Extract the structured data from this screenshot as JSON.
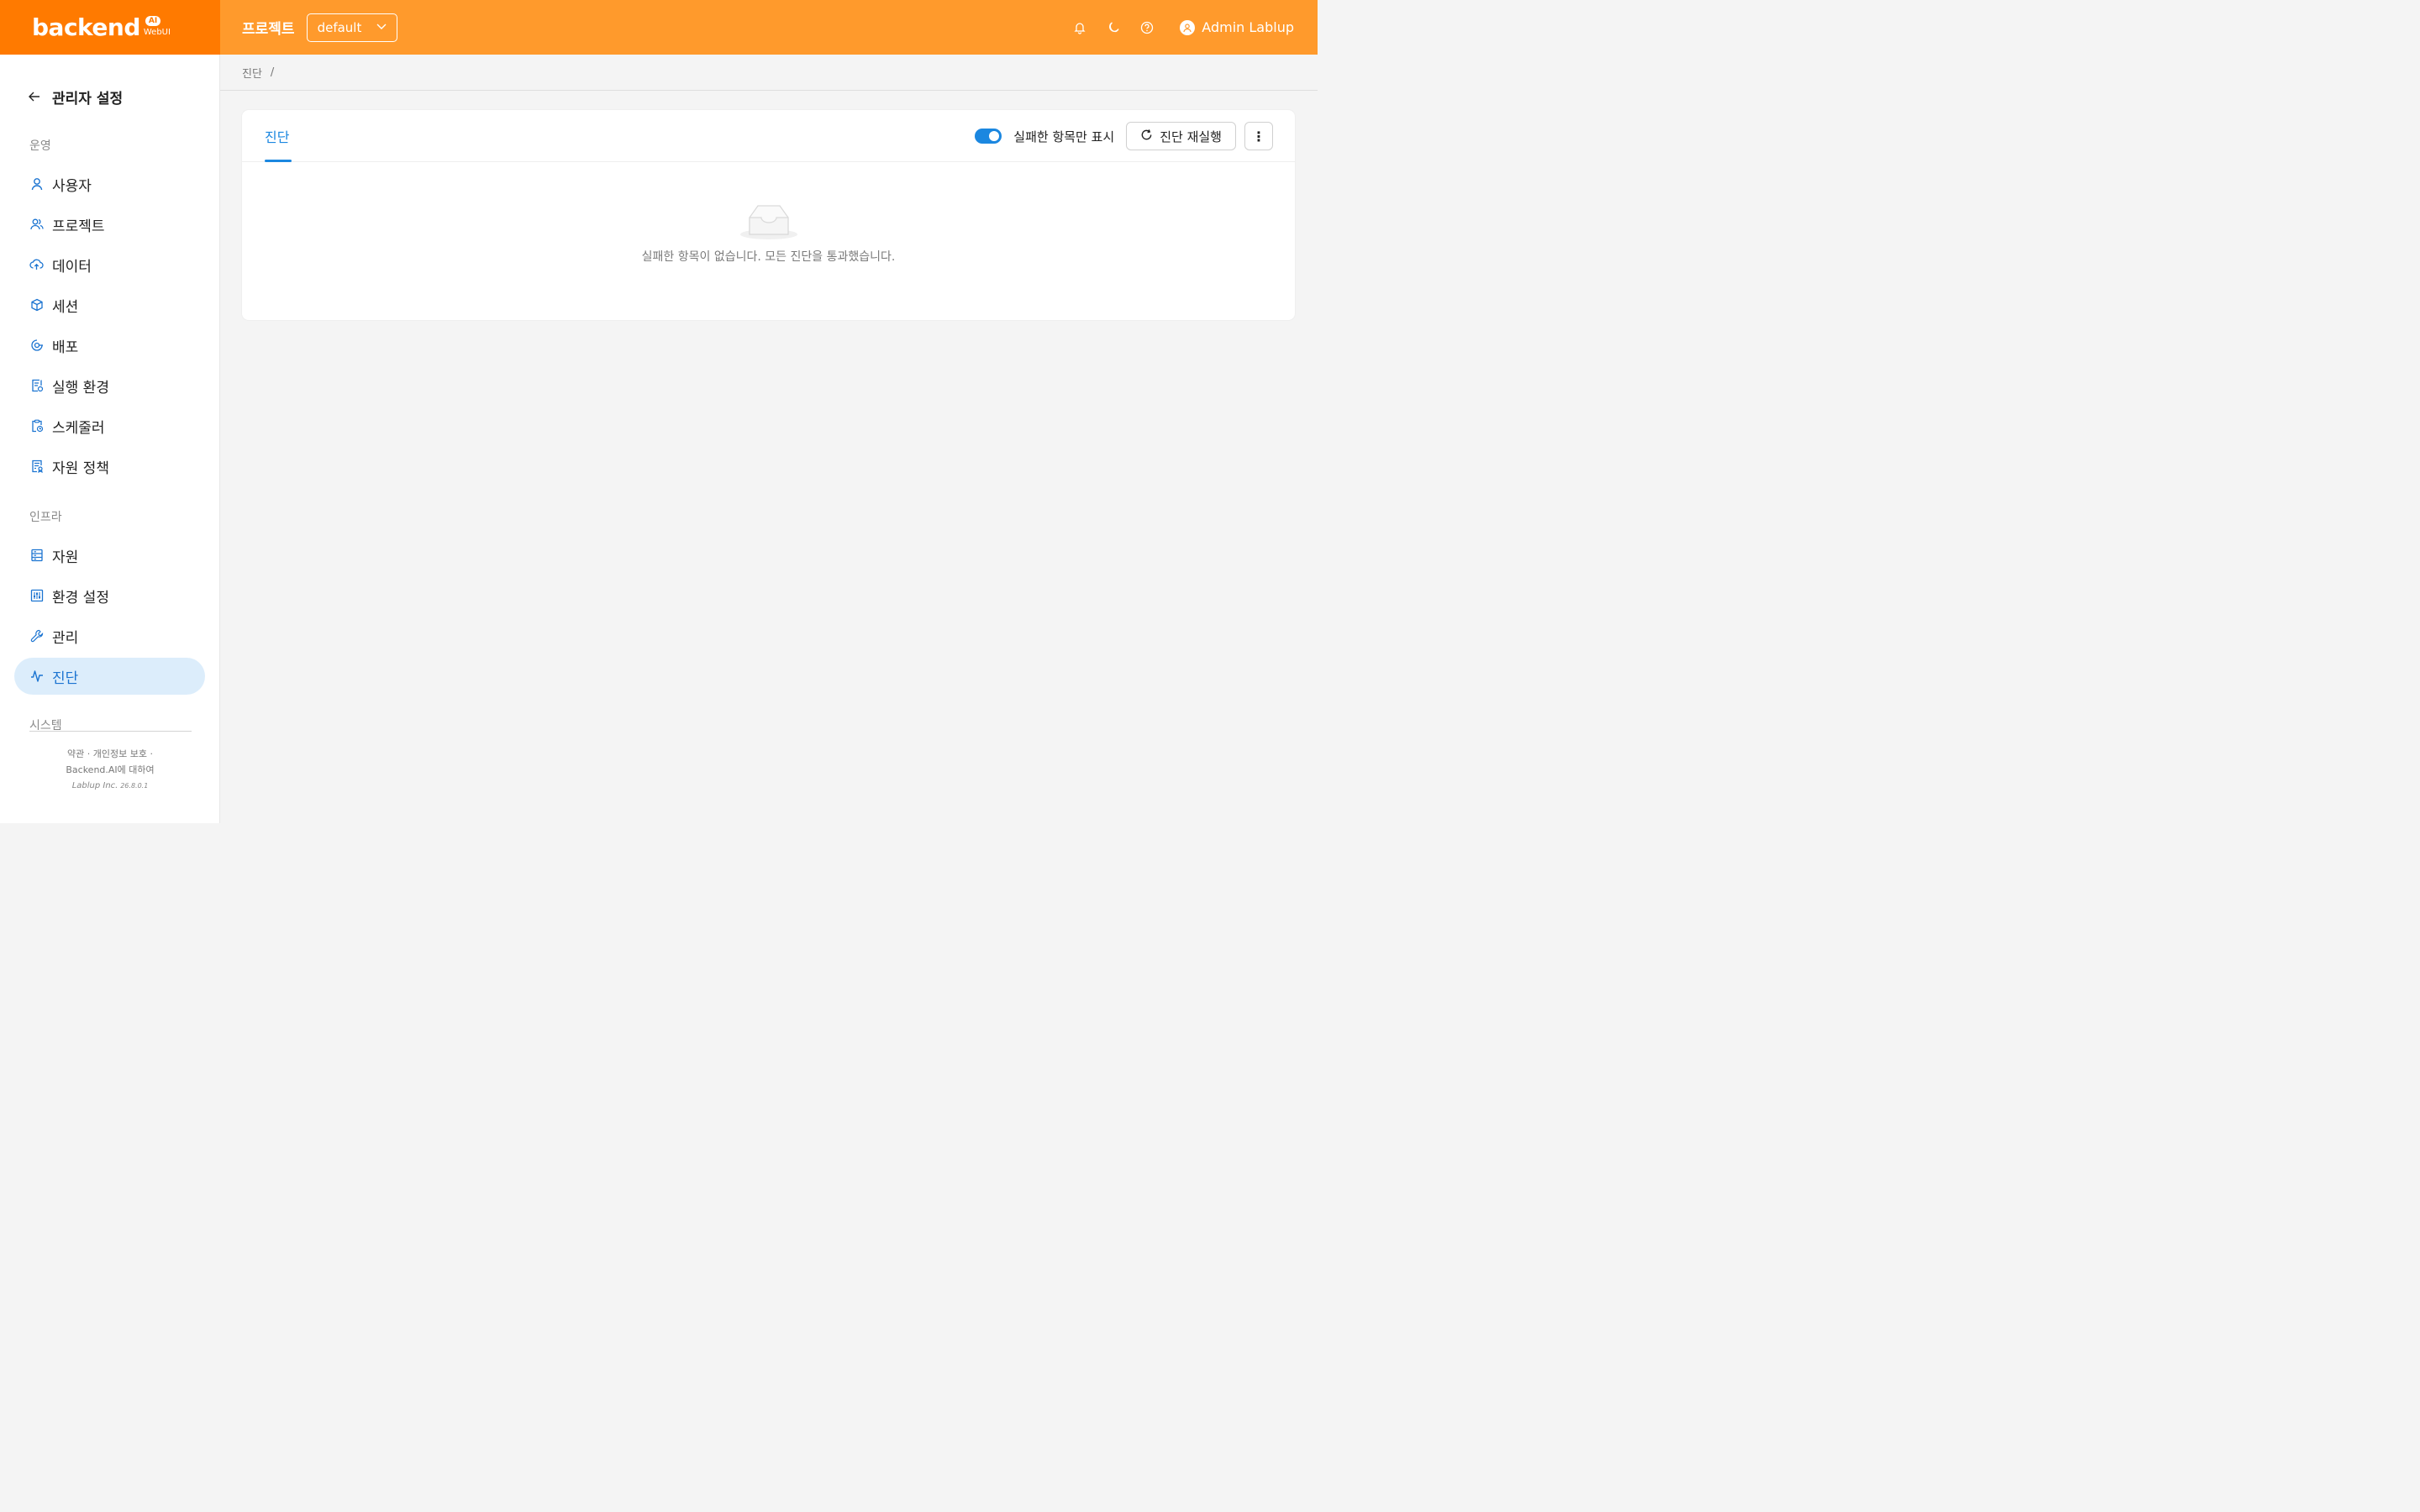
{
  "header": {
    "logo_text": "backend",
    "logo_badge": "AI",
    "logo_sub": "WebUI",
    "project_label": "프로젝트",
    "project_value": "default",
    "user_name": "Admin Lablup"
  },
  "sidebar": {
    "title": "관리자 설정",
    "section_operation": "운영",
    "section_infra": "인프라",
    "section_system": "시스템",
    "items": [
      {
        "label": "사용자",
        "icon": "user-icon"
      },
      {
        "label": "프로젝트",
        "icon": "users-icon"
      },
      {
        "label": "데이터",
        "icon": "cloud-upload-icon"
      },
      {
        "label": "세션",
        "icon": "cube-icon"
      },
      {
        "label": "배포",
        "icon": "deploy-icon"
      },
      {
        "label": "실행 환경",
        "icon": "file-settings-icon"
      },
      {
        "label": "스케줄러",
        "icon": "clipboard-clock-icon"
      },
      {
        "label": "자원 정책",
        "icon": "policy-icon"
      },
      {
        "label": "자원",
        "icon": "server-icon"
      },
      {
        "label": "환경 설정",
        "icon": "sliders-icon"
      },
      {
        "label": "관리",
        "icon": "wrench-icon"
      },
      {
        "label": "진단",
        "icon": "activity-icon"
      }
    ],
    "footer_line1": "약관 · 개인정보 보호 ·",
    "footer_line2": "Backend.AI에 대하여",
    "footer_company": "Lablup Inc.",
    "footer_version": "26.8.0.1"
  },
  "breadcrumb": {
    "item": "진단",
    "separator": "/"
  },
  "main": {
    "tab_label": "진단",
    "toggle_label": "실패한 항목만 표시",
    "toggle_on": true,
    "rerun_label": "진단 재실행",
    "more_label": "⋮",
    "empty_text": "실패한 항목이 없습니다. 모든 진단을 통과했습니다."
  },
  "colors": {
    "brand_orange": "#ff7a00",
    "topbar_orange": "#ff9a2c",
    "accent_blue": "#1b87e0",
    "active_bg": "#dcedfb"
  }
}
